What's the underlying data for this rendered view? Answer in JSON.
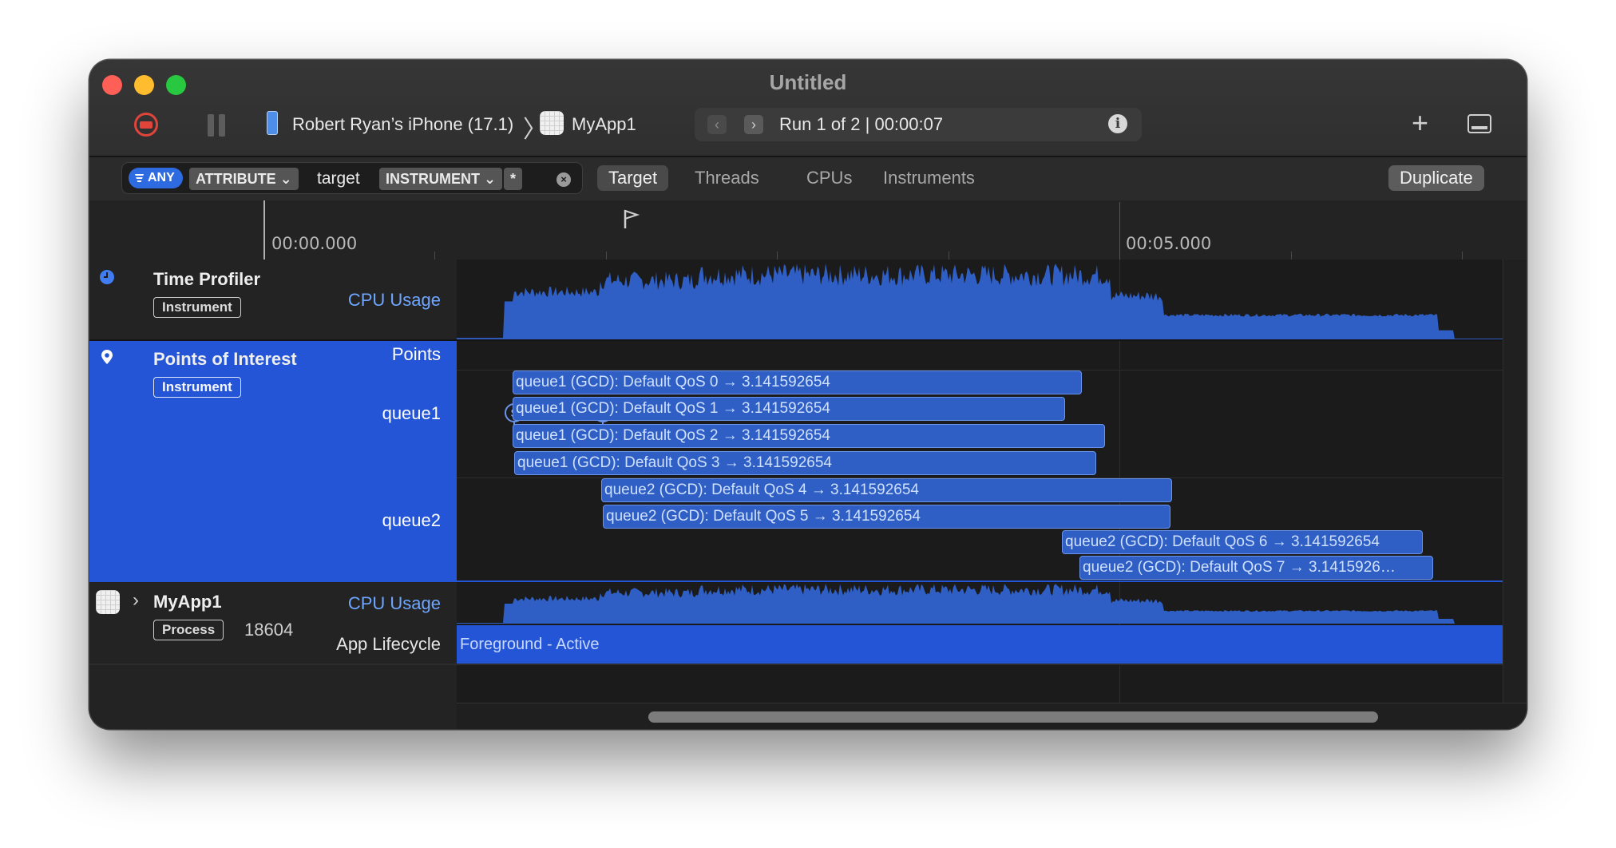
{
  "window": {
    "title": "Untitled"
  },
  "toolbar": {
    "record_icon": "record-stop-icon",
    "pause_icon": "pause-icon",
    "device_icon": "iphone-icon",
    "device_name": "Robert Ryan’s iPhone (17.1)",
    "breadcrumb_separator": "〉",
    "app_icon": "app-icon",
    "app_name": "MyApp1",
    "run_label": "Run 1 of 2  |  00:00:07",
    "prev_icon": "chevron-left-icon",
    "next_icon": "chevron-right-icon",
    "info_icon": "info-icon",
    "add_icon": "plus-icon",
    "panel_icon": "toggle-panel-icon"
  },
  "filter": {
    "any_label": "ANY",
    "attribute_label": "ATTRIBUTE ⌄",
    "attribute_value": "target",
    "instrument_label": "INSTRUMENT ⌄",
    "instrument_value": "*",
    "clear_icon": "clear-icon"
  },
  "tabs": [
    {
      "label": "Target",
      "active": true
    },
    {
      "label": "Threads",
      "active": false
    },
    {
      "label": "CPUs",
      "active": false
    },
    {
      "label": "Instruments",
      "active": false
    }
  ],
  "duplicate_label": "Duplicate",
  "ruler": {
    "labels": [
      "00:00.000",
      "00:05.000"
    ]
  },
  "tracks": {
    "time_profiler": {
      "title": "Time Profiler",
      "badge": "Instrument",
      "sub_label": "CPU Usage",
      "icon": "clock-icon"
    },
    "poi": {
      "title": "Points of Interest",
      "badge": "Instrument",
      "points_label": "Points",
      "queue1_label": "queue1",
      "queue2_label": "queue2",
      "icon": "location-pin-icon",
      "marker_label": "S",
      "bars": [
        "queue1 (GCD): Default QoS 0 → 3.141592654",
        "queue1 (GCD): Default QoS 1 → 3.141592654",
        "queue1 (GCD): Default QoS 2 → 3.141592654",
        "queue1 (GCD): Default QoS 3 → 3.141592654",
        "queue2 (GCD): Default QoS 4 → 3.141592654",
        "queue2 (GCD): Default QoS 5 → 3.141592654",
        "queue2 (GCD): Default QoS 6 → 3.141592654",
        "queue2 (GCD): Default QoS 7 → 3.1415926…"
      ]
    },
    "process": {
      "title": "MyApp1",
      "badge": "Process",
      "pid": "18604",
      "cpu_label": "CPU Usage",
      "lifecycle_label": "App Lifecycle",
      "lifecycle_value": "Foreground - Active",
      "disclosure_icon": "chevron-right-icon"
    }
  },
  "colors": {
    "accent": "#2555d7",
    "graph_fill": "#2f5fc4",
    "window_bg": "#232323"
  }
}
